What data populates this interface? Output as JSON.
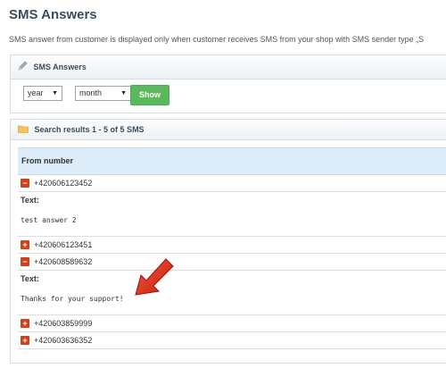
{
  "page": {
    "title": "SMS Answers",
    "intro": "SMS answer from customer is displayed only when customer receives SMS from your shop with SMS sender type „S"
  },
  "filter": {
    "title": "SMS Answers",
    "year_value": "year",
    "month_value": "month",
    "show_label": "Show"
  },
  "results": {
    "title": "Search results 1 - 5 of 5 SMS",
    "column_header": "From number",
    "text_label": "Text:",
    "rows": [
      {
        "number": "+420606123452",
        "expanded": true,
        "text": "test answer 2"
      },
      {
        "number": "+420606123451",
        "expanded": false
      },
      {
        "number": "+420608589632",
        "expanded": true,
        "text": "Thanks for your support!"
      },
      {
        "number": "+420603859999",
        "expanded": false
      },
      {
        "number": "+420603636352",
        "expanded": false
      }
    ]
  },
  "colors": {
    "accent_button": "#5cb85c",
    "toggle": "#d0411b",
    "header_row": "#dcecf8",
    "annotation_arrow": "#e22b1b"
  },
  "icons": {
    "filter_header": "pencil-icon",
    "results_header": "folder-icon",
    "collapse": "minus-icon",
    "expand": "plus-icon",
    "annotation": "red-arrow-icon"
  }
}
